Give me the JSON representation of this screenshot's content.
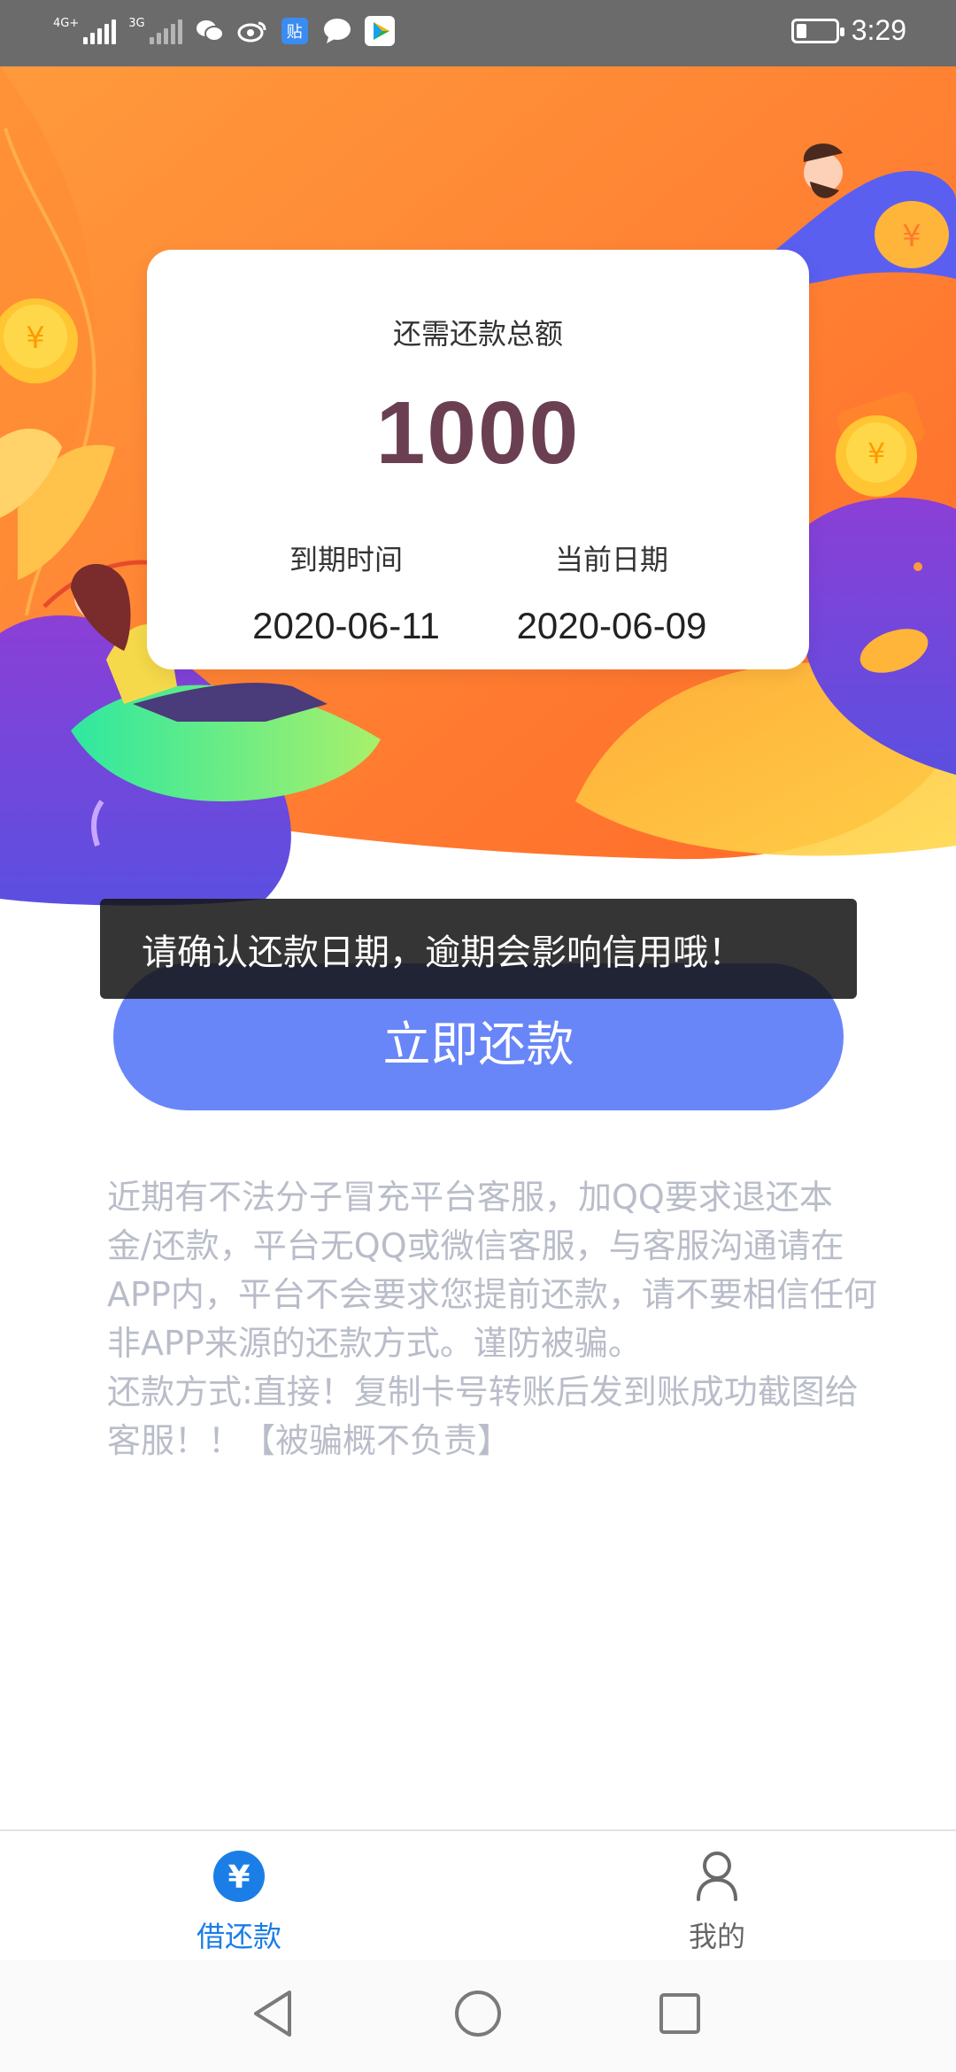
{
  "status_bar": {
    "signal1_label": "4G+",
    "signal2_label": "3G",
    "notification_icons": [
      "wechat-icon",
      "weibo-icon",
      "tieba-icon",
      "message-icon",
      "video-app-icon"
    ],
    "tieba_label": "贴",
    "time": "3:29"
  },
  "card": {
    "total_label": "还需还款总额",
    "total_amount": "1000",
    "due_label": "到期时间",
    "due_date": "2020-06-11",
    "current_label": "当前日期",
    "current_date": "2020-06-09"
  },
  "toast": "请确认还款日期，逾期会影响信用哦！",
  "repay_button": "立即还款",
  "notice": {
    "paragraph1": "近期有不法分子冒充平台客服，加QQ要求退还本金/还款，平台无QQ或微信客服，与客服沟通请在APP内，平台不会要求您提前还款，请不要相信任何非APP来源的还款方式。谨防被骗。",
    "paragraph2": "还款方式:直接！复制卡号转账后发到账成功截图给客服！！【被骗概不负责】"
  },
  "tabs": [
    {
      "label": "借还款",
      "icon": "yuan-icon",
      "active": true
    },
    {
      "label": "我的",
      "icon": "user-icon",
      "active": false
    }
  ],
  "colors": {
    "accent": "#6886f8",
    "amount": "#6b3f52",
    "tab_active": "#1a7ee6",
    "hero_orange": "#ff7a2e"
  }
}
